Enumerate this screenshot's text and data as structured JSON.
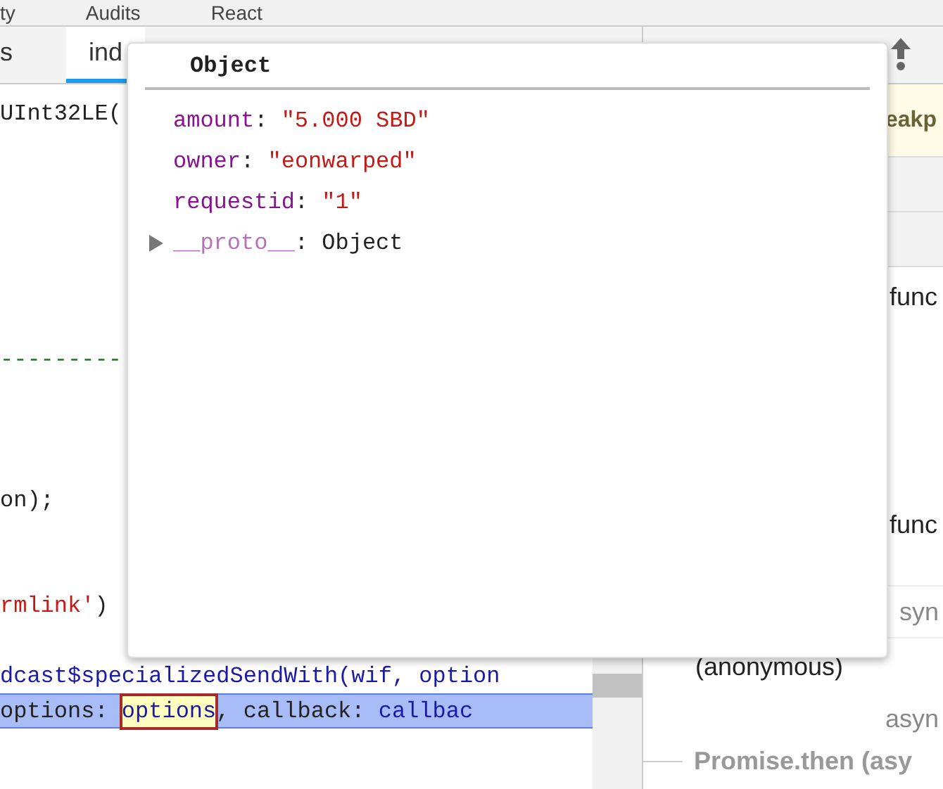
{
  "top_tabs": [
    {
      "label": "ty"
    },
    {
      "label": "Audits"
    },
    {
      "label": "React"
    }
  ],
  "source_tabs": [
    {
      "label": "s",
      "selected": false
    },
    {
      "label": "ind",
      "selected": true
    }
  ],
  "code_lines": [
    {
      "kind": "code",
      "selected": false,
      "segments": [
        {
          "kind": "plain",
          "text": "UInt32LE("
        }
      ]
    },
    {
      "kind": "blank"
    },
    {
      "kind": "blank"
    },
    {
      "kind": "blank"
    },
    {
      "kind": "blank"
    },
    {
      "kind": "blank"
    },
    {
      "kind": "blank"
    },
    {
      "kind": "code",
      "selected": false,
      "segments": [
        {
          "kind": "comment",
          "text": "---------"
        }
      ]
    },
    {
      "kind": "blank"
    },
    {
      "kind": "blank"
    },
    {
      "kind": "blank"
    },
    {
      "kind": "code",
      "selected": false,
      "segments": [
        {
          "kind": "plain",
          "text": "on);"
        }
      ]
    },
    {
      "kind": "blank"
    },
    {
      "kind": "blank"
    },
    {
      "kind": "code",
      "selected": false,
      "segments": [
        {
          "kind": "string",
          "text": "rmlink'"
        },
        {
          "kind": "plain",
          "text": ")"
        }
      ]
    },
    {
      "kind": "blank"
    },
    {
      "kind": "code",
      "selected": false,
      "segments": [
        {
          "kind": "name",
          "text": "dcast$specializedSendWith(wif, option"
        }
      ]
    },
    {
      "kind": "code",
      "selected": true,
      "segments": [
        {
          "kind": "plain",
          "text": "options: "
        },
        {
          "kind": "hovered",
          "text": "options"
        },
        {
          "kind": "plain",
          "text": ", callback: "
        },
        {
          "kind": "name",
          "text": "callbac"
        }
      ]
    }
  ],
  "right_pane": {
    "banner": "eakp",
    "rows": [
      {
        "kind": "gray"
      },
      {
        "kind": "gray"
      },
      {
        "kind": "tail",
        "text": "func"
      },
      {
        "kind": "blank"
      },
      {
        "kind": "blank"
      },
      {
        "kind": "blank"
      },
      {
        "kind": "tail",
        "text": "func"
      },
      {
        "kind": "spacer"
      },
      {
        "kind": "async",
        "text": "syn"
      },
      {
        "kind": "frame",
        "text": "(anonymous)"
      },
      {
        "kind": "async",
        "text": "asyn"
      },
      {
        "kind": "async_header",
        "text": "Promise.then (asy"
      }
    ]
  },
  "popup": {
    "title": "Object",
    "properties": [
      {
        "kind": "string",
        "key": "amount",
        "separator": ":",
        "value": "\"5.000 SBD\""
      },
      {
        "kind": "string",
        "key": "owner",
        "separator": ":",
        "value": "\"eonwarped\""
      },
      {
        "kind": "string",
        "key": "requestid",
        "separator": ":",
        "value": "\"1\""
      },
      {
        "kind": "object",
        "key": "__proto__",
        "separator": ":",
        "value": "Object",
        "expanded": false
      }
    ]
  }
}
